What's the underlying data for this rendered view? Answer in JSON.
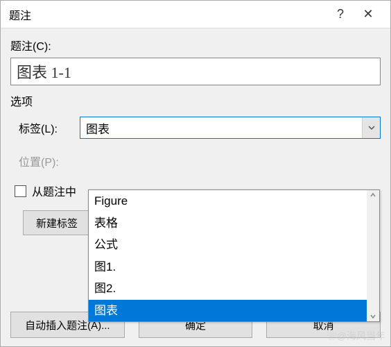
{
  "titlebar": {
    "title": "题注",
    "help": "?",
    "close": "✕"
  },
  "caption": {
    "label": "题注(C):",
    "value": "图表 1-1"
  },
  "options": {
    "section_label": "选项",
    "label_row": {
      "label": "标签(L):",
      "value": "图表"
    },
    "position_row": {
      "label": "位置(P):"
    },
    "checkbox": {
      "label": "从题注中"
    }
  },
  "dropdown": {
    "items": [
      {
        "label": "Figure",
        "selected": false
      },
      {
        "label": "表格",
        "selected": false
      },
      {
        "label": "公式",
        "selected": false
      },
      {
        "label": "图1.",
        "selected": false
      },
      {
        "label": "图2.",
        "selected": false
      },
      {
        "label": "图表",
        "selected": true
      }
    ]
  },
  "buttons": {
    "new_label": "新建标签",
    "auto_insert": "自动插入题注(A)...",
    "ok": "确定",
    "cancel": "取消"
  },
  "watermark": "❀@海风当年"
}
